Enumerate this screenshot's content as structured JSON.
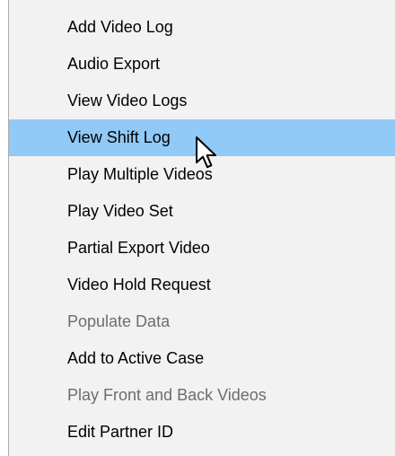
{
  "context_menu": {
    "items": [
      {
        "label": "Add Video Log",
        "state": "enabled"
      },
      {
        "label": "Audio Export",
        "state": "enabled"
      },
      {
        "label": "View Video Logs",
        "state": "enabled"
      },
      {
        "label": "View Shift Log",
        "state": "highlighted"
      },
      {
        "label": "Play Multiple Videos",
        "state": "enabled"
      },
      {
        "label": "Play Video Set",
        "state": "enabled"
      },
      {
        "label": "Partial Export Video",
        "state": "enabled"
      },
      {
        "label": "Video Hold Request",
        "state": "enabled"
      },
      {
        "label": "Populate Data",
        "state": "disabled"
      },
      {
        "label": "Add to Active Case",
        "state": "enabled"
      },
      {
        "label": "Play Front and Back Videos",
        "state": "disabled"
      },
      {
        "label": "Edit Partner ID",
        "state": "enabled"
      }
    ]
  },
  "cursor": {
    "icon": "arrow-pointer-icon"
  },
  "colors": {
    "menu_background": "#f2f2f2",
    "highlight": "#91c9f7",
    "text": "#000000",
    "disabled_text": "#6d6d6d",
    "border": "#adadad"
  }
}
